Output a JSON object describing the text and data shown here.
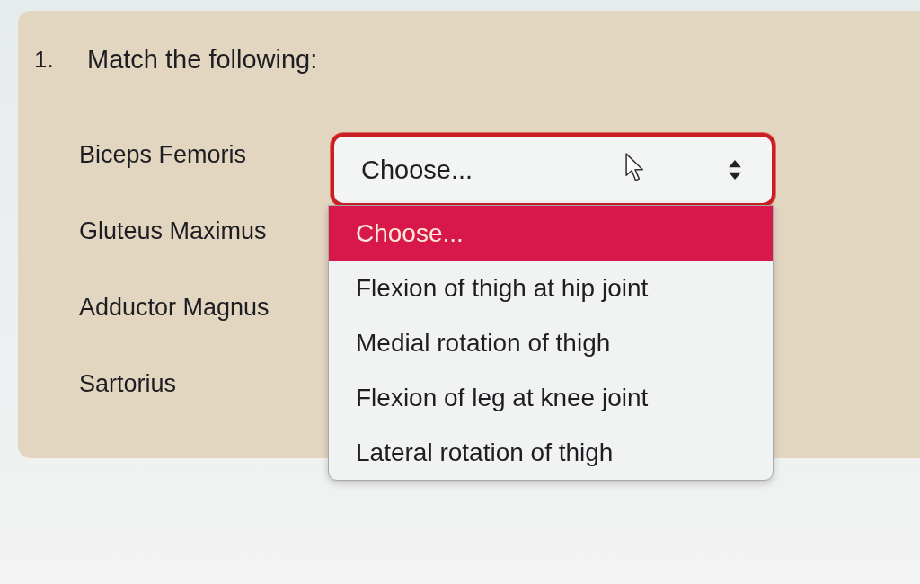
{
  "question": {
    "number": "1.",
    "prompt": "Match the following:"
  },
  "terms": [
    "Biceps Femoris",
    "Gluteus Maximus",
    "Adductor Magnus",
    "Sartorius"
  ],
  "select": {
    "value": "Choose...",
    "focused": true,
    "expanded": true,
    "options": [
      {
        "label": "Choose...",
        "selected": true
      },
      {
        "label": "Flexion of thigh at hip joint",
        "selected": false
      },
      {
        "label": "Medial rotation of thigh",
        "selected": false
      },
      {
        "label": "Flexion of leg at knee joint",
        "selected": false
      },
      {
        "label": "Lateral rotation of thigh",
        "selected": false
      }
    ]
  }
}
